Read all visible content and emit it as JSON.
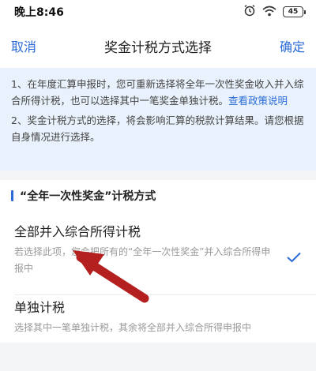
{
  "status_bar": {
    "time": "晚上8:46",
    "battery": "45",
    "icons": [
      "alarm-icon",
      "wifi-icon",
      "battery-icon"
    ]
  },
  "nav": {
    "cancel": "取消",
    "title": "奖金计税方式选择",
    "confirm": "确定"
  },
  "notice": {
    "line1_text": "1、在年度汇算申报时，您可重新选择将全年一次性奖金收入并入综合所得计税，也可以选择其中一笔奖金单独计税。",
    "line1_link": "查看政策说明",
    "line2_text": "2、奖金计税方式的选择，将会影响汇算的税款计算结果。请您根据自身情况进行选择。"
  },
  "section": {
    "title": "“全年一次性奖金”计税方式"
  },
  "options": [
    {
      "title": "全部并入综合所得计税",
      "desc": "若选择此项，您会把所有的“全年一次性奖金”并入综合所得申报中",
      "selected": true
    },
    {
      "title": "单独计税",
      "desc": "选择其中一笔单独计税，其余将全部并入综合所得申报中",
      "selected": false
    }
  ],
  "colors": {
    "accent": "#2a6bd8",
    "notice_bg": "#e9f2fc",
    "annotation_arrow": "#b3201f"
  }
}
